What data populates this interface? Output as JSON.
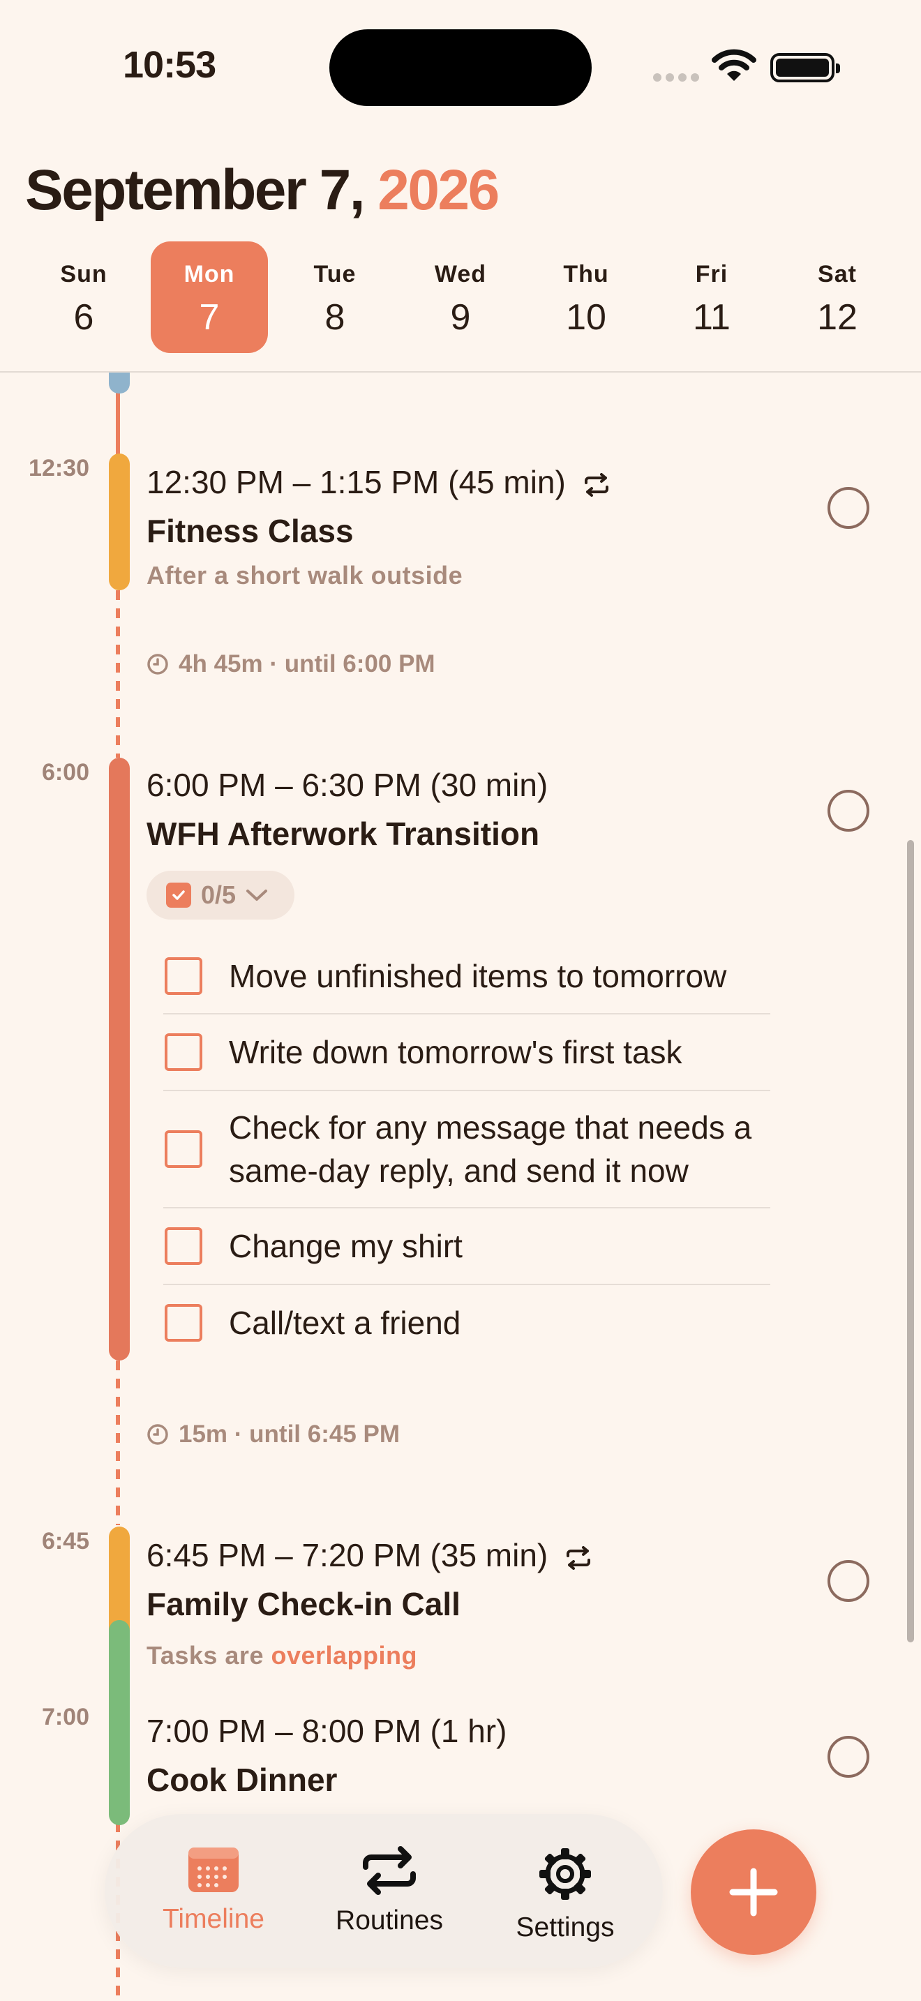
{
  "status_bar": {
    "time": "10:53"
  },
  "header": {
    "month_day": "September 7,",
    "year": "2026"
  },
  "week": [
    {
      "name": "Sun",
      "num": "6"
    },
    {
      "name": "Mon",
      "num": "7",
      "selected": true
    },
    {
      "name": "Tue",
      "num": "8"
    },
    {
      "name": "Wed",
      "num": "9"
    },
    {
      "name": "Thu",
      "num": "10"
    },
    {
      "name": "Fri",
      "num": "11"
    },
    {
      "name": "Sat",
      "num": "12"
    }
  ],
  "timeline": {
    "hours": [
      "12:30",
      "6:00",
      "6:45",
      "7:00"
    ],
    "events": [
      {
        "time": "12:30 PM – 1:15 PM (45 min)",
        "title": "Fitness Class",
        "subtitle": "After a short walk outside",
        "color": "#f0a83e",
        "repeat": true
      },
      {
        "time": "6:00 PM – 6:30 PM (30 min)",
        "title": "WFH Afterwork Transition",
        "color": "#e4785b",
        "subtasks_count": "0/5",
        "checklist": [
          "Move unfinished items to tomorrow",
          "Write down tomorrow's first task",
          "Check for any message that needs a same-day reply, and send it now",
          "Change my shirt",
          "Call/text a friend"
        ]
      },
      {
        "time": "6:45 PM – 7:20 PM (35 min)",
        "title": "Family Check-in Call",
        "subtitle_prefix": "Tasks are",
        "subtitle_highlight": "overlapping",
        "color": "#f0a83e",
        "repeat": true
      },
      {
        "time": "7:00 PM – 8:00 PM (1 hr)",
        "title": "Cook Dinner",
        "color": "#7bbb7a"
      }
    ],
    "gaps": [
      "4h 45m · until 6:00 PM",
      "15m · until 6:45 PM"
    ]
  },
  "tabbar": {
    "timeline": "Timeline",
    "routines": "Routines",
    "settings": "Settings"
  },
  "colors": {
    "accent": "#ec7e5d",
    "background": "#fdf5ee"
  },
  "icons": {
    "fab": "plus-icon",
    "repeat": "repeat-icon",
    "clock": "clock-icon"
  }
}
